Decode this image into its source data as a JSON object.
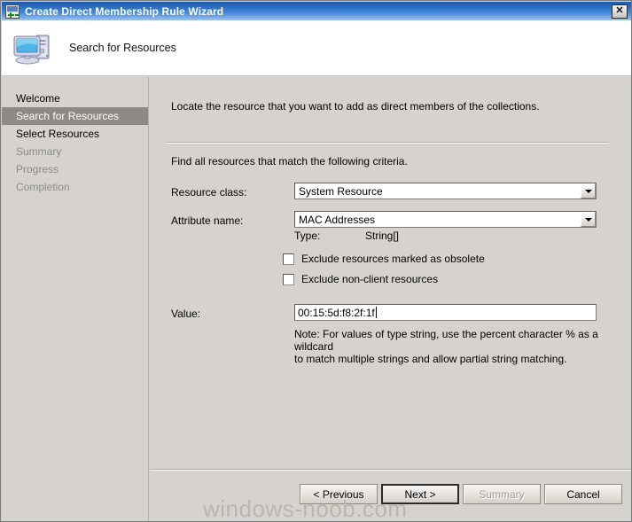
{
  "window": {
    "title": "Create Direct Membership Rule Wizard",
    "icon": "wizard-icon",
    "close_label": "✕"
  },
  "header": {
    "title": "Search for Resources",
    "icon": "computer-icon"
  },
  "sidebar": {
    "items": [
      {
        "label": "Welcome",
        "state": "normal"
      },
      {
        "label": "Search for Resources",
        "state": "active"
      },
      {
        "label": "Select Resources",
        "state": "normal"
      },
      {
        "label": "Summary",
        "state": "dim"
      },
      {
        "label": "Progress",
        "state": "dim"
      },
      {
        "label": "Completion",
        "state": "dim"
      }
    ]
  },
  "main": {
    "intro": "Locate the resource that you want to add as direct members of the collections.",
    "criteria_text": "Find all resources that match the following criteria.",
    "resource_class": {
      "label": "Resource class:",
      "value": "System Resource"
    },
    "attribute_name": {
      "label": "Attribute name:",
      "value": "MAC Addresses"
    },
    "type": {
      "label": "Type:",
      "value": "String[]"
    },
    "checkbox_obsolete": {
      "label": "Exclude resources marked as obsolete",
      "checked": false
    },
    "checkbox_nonclient": {
      "label": "Exclude non-client resources",
      "checked": false
    },
    "value_field": {
      "label": "Value:",
      "value": "00:15:5d:f8:2f:1f",
      "placeholder": ""
    },
    "note_line1": "Note: For values of type string, use the percent character % as a wildcard",
    "note_line2": "to match multiple strings and allow partial string matching."
  },
  "buttons": {
    "previous": "< Previous",
    "next": "Next >",
    "summary": "Summary",
    "cancel": "Cancel"
  },
  "watermark": {
    "text": "windows-noob.com"
  },
  "colors": {
    "titlebar_blue": "#2f6fba",
    "dialog_face": "#d6d3ce",
    "sidebar_active": "#8d8a85",
    "disabled_text": "#a2a09b",
    "watermark": "#b9b6b0"
  }
}
